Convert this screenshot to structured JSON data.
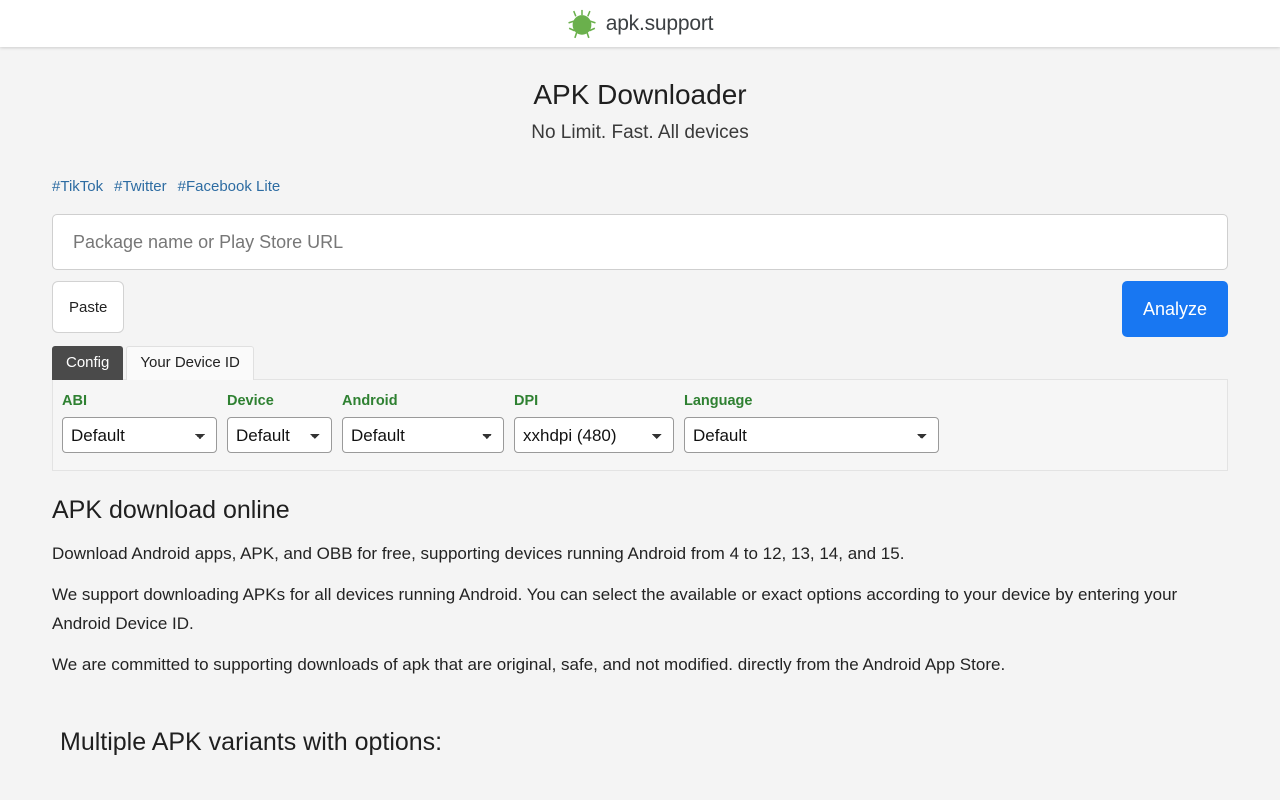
{
  "header": {
    "brand_name": "apk.support",
    "logo_icon": "android-bug-icon"
  },
  "hero": {
    "title": "APK Downloader",
    "subtitle": "No Limit. Fast. All devices"
  },
  "tag_links": [
    {
      "label": "#TikTok"
    },
    {
      "label": "#Twitter"
    },
    {
      "label": "#Facebook Lite"
    }
  ],
  "search": {
    "placeholder": "Package name or Play Store URL",
    "value": "",
    "paste_label": "Paste",
    "analyze_label": "Analyze"
  },
  "tabs": [
    {
      "label": "Config",
      "active": true
    },
    {
      "label": "Your Device ID",
      "active": false
    }
  ],
  "config": {
    "fields": [
      {
        "label": "ABI",
        "value": "Default",
        "options": [
          "Default"
        ]
      },
      {
        "label": "Device",
        "value": "Default",
        "options": [
          "Default"
        ]
      },
      {
        "label": "Android",
        "value": "Default",
        "options": [
          "Default"
        ]
      },
      {
        "label": "DPI",
        "value": "xxhdpi (480)",
        "options": [
          "xxhdpi (480)"
        ]
      },
      {
        "label": "Language",
        "value": "Default",
        "options": [
          "Default"
        ]
      }
    ]
  },
  "content": {
    "heading": "APK download online",
    "paragraphs": [
      "Download Android apps, APK, and OBB for free, supporting devices running Android from 4 to 12, 13, 14, and 15.",
      "We support downloading APKs for all devices running Android. You can select the available or exact options according to your device by entering your Android Device ID.",
      "We are committed to supporting downloads of apk that are original, safe, and not modified. directly from the Android App Store."
    ],
    "variants_heading": "Multiple APK variants with options:"
  },
  "colors": {
    "accent_blue": "#1877f2",
    "link_blue": "#2d6ca2",
    "label_green": "#2f8132",
    "logo_green": "#6ab04c",
    "tab_active_bg": "#4a4a4a",
    "page_bg": "#f4f4f4"
  }
}
